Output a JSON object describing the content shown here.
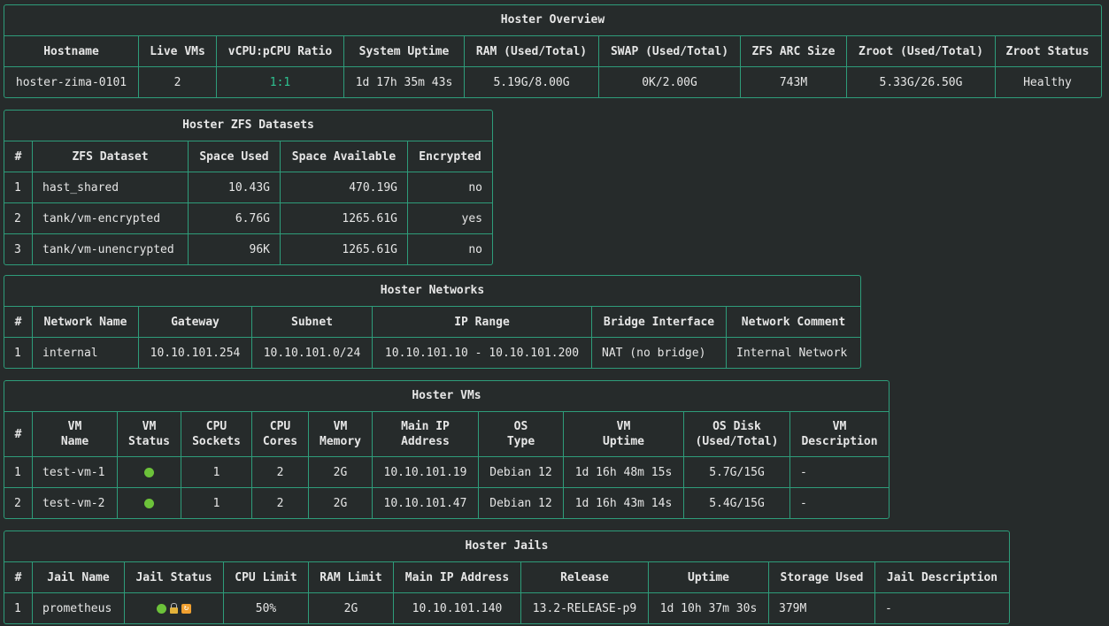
{
  "overview": {
    "title": "Hoster Overview",
    "headers": [
      "Hostname",
      "Live VMs",
      "vCPU:pCPU Ratio",
      "System Uptime",
      "RAM (Used/Total)",
      "SWAP (Used/Total)",
      "ZFS ARC Size",
      "Zroot (Used/Total)",
      "Zroot Status"
    ],
    "row": [
      "hoster-zima-0101",
      "2",
      "1:1",
      "1d 17h 35m 43s",
      "5.19G/8.00G",
      "0K/2.00G",
      "743M",
      "5.33G/26.50G",
      "Healthy"
    ],
    "accent_color": "#2ec290"
  },
  "datasets": {
    "title": "Hoster ZFS Datasets",
    "headers": [
      "#",
      "ZFS Dataset",
      "Space Used",
      "Space Available",
      "Encrypted"
    ],
    "rows": [
      [
        "1",
        "hast_shared",
        "10.43G",
        "470.19G",
        "no"
      ],
      [
        "2",
        "tank/vm-encrypted",
        "6.76G",
        "1265.61G",
        "yes"
      ],
      [
        "3",
        "tank/vm-unencrypted",
        "96K",
        "1265.61G",
        "no"
      ]
    ]
  },
  "networks": {
    "title": "Hoster Networks",
    "headers": [
      "#",
      "Network Name",
      "Gateway",
      "Subnet",
      "IP Range",
      "Bridge Interface",
      "Network Comment"
    ],
    "rows": [
      [
        "1",
        "internal",
        "10.10.101.254",
        "10.10.101.0/24",
        "10.10.101.10 - 10.10.101.200",
        "NAT (no bridge)",
        "Internal Network"
      ]
    ]
  },
  "vms": {
    "title": "Hoster VMs",
    "headers": [
      [
        "#",
        ""
      ],
      [
        "VM",
        "Name"
      ],
      [
        "VM",
        "Status"
      ],
      [
        "CPU",
        "Sockets"
      ],
      [
        "CPU",
        "Cores"
      ],
      [
        "VM",
        "Memory"
      ],
      [
        "Main IP",
        "Address"
      ],
      [
        "OS",
        "Type"
      ],
      [
        "VM",
        "Uptime"
      ],
      [
        "OS Disk",
        "(Used/Total)"
      ],
      [
        "VM",
        "Description"
      ]
    ],
    "rows": [
      [
        "1",
        "test-vm-1",
        "running-dot-icon",
        "1",
        "2",
        "2G",
        "10.10.101.19",
        "Debian 12",
        "1d 16h 48m 15s",
        "5.7G/15G",
        "-"
      ],
      [
        "2",
        "test-vm-2",
        "running-dot-icon",
        "1",
        "2",
        "2G",
        "10.10.101.47",
        "Debian 12",
        "1d 16h 43m 14s",
        "5.4G/15G",
        "-"
      ]
    ],
    "status_color": "#6cc23a"
  },
  "jails": {
    "title": "Hoster Jails",
    "headers": [
      "#",
      "Jail Name",
      "Jail Status",
      "CPU Limit",
      "RAM Limit",
      "Main IP Address",
      "Release",
      "Uptime",
      "Storage Used",
      "Jail Description"
    ],
    "rows": [
      [
        "1",
        "prometheus",
        "running-dot-icon lock-icon restart-icon",
        "50%",
        "2G",
        "10.10.101.140",
        "13.2-RELEASE-p9",
        "1d 10h 37m 30s",
        "379M",
        "-"
      ]
    ]
  }
}
